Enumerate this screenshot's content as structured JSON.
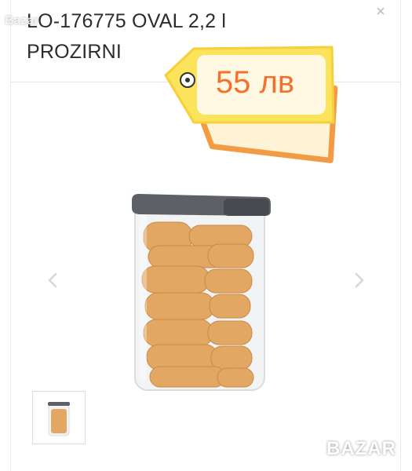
{
  "product": {
    "title": "LO-176775 OVAL 2,2 l PROZIRNI",
    "price": "55 лв"
  },
  "modal": {
    "close_label": "×"
  },
  "watermarks": {
    "top": "Bazar",
    "bottom": "BAZAR"
  },
  "colors": {
    "tag_yellow": "#fbe35b",
    "tag_orange": "#f39a45",
    "price_text": "#f4702c",
    "lid": "#5d6167"
  }
}
